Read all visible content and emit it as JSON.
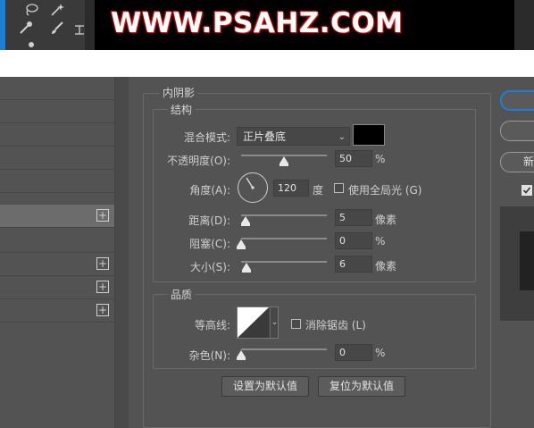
{
  "banner": {
    "watermark": "WWW.PSAHZ.COM"
  },
  "toolbar": {
    "icons": [
      "lasso-icon",
      "magic-wand-icon",
      "eyedropper-icon",
      "brush-icon",
      "type-icon",
      "pen-icon"
    ]
  },
  "left_panel": {
    "rows": [
      {
        "has_plus": false
      },
      {
        "has_plus": false
      },
      {
        "has_plus": false
      },
      {
        "has_plus": false
      },
      {
        "has_plus": false
      },
      {
        "has_plus": true,
        "selected": true
      },
      {
        "has_plus": false
      },
      {
        "has_plus": true
      },
      {
        "has_plus": true
      },
      {
        "has_plus": true
      }
    ]
  },
  "dialog": {
    "section_title": "内阴影",
    "structure": {
      "title": "结构",
      "blend_mode_label": "混合模式:",
      "blend_mode_value": "正片叠底",
      "blend_color": "#000000",
      "opacity_label": "不透明度(O):",
      "opacity_value": "50",
      "opacity_unit": "%",
      "opacity_level": 0.5,
      "angle_label": "角度(A):",
      "angle_value": "120",
      "angle_unit": "度",
      "global_light_label": "使用全局光 (G)",
      "global_light_checked": false,
      "distance_label": "距离(D):",
      "distance_value": "5",
      "distance_unit": "像素",
      "choke_label": "阻塞(C):",
      "choke_value": "0",
      "choke_unit": "%",
      "size_label": "大小(S):",
      "size_value": "6",
      "size_unit": "像素"
    },
    "quality": {
      "title": "品质",
      "contour_label": "等高线:",
      "antialias_label": "消除锯齿 (L)",
      "antialias_checked": false,
      "noise_label": "杂色(N):",
      "noise_value": "0",
      "noise_unit": "%"
    },
    "buttons": {
      "set_default": "设置为默认值",
      "reset_default": "复位为默认值"
    }
  },
  "right_panel": {
    "new_button_label": "新建",
    "accent_color": "#1c7ed6"
  }
}
